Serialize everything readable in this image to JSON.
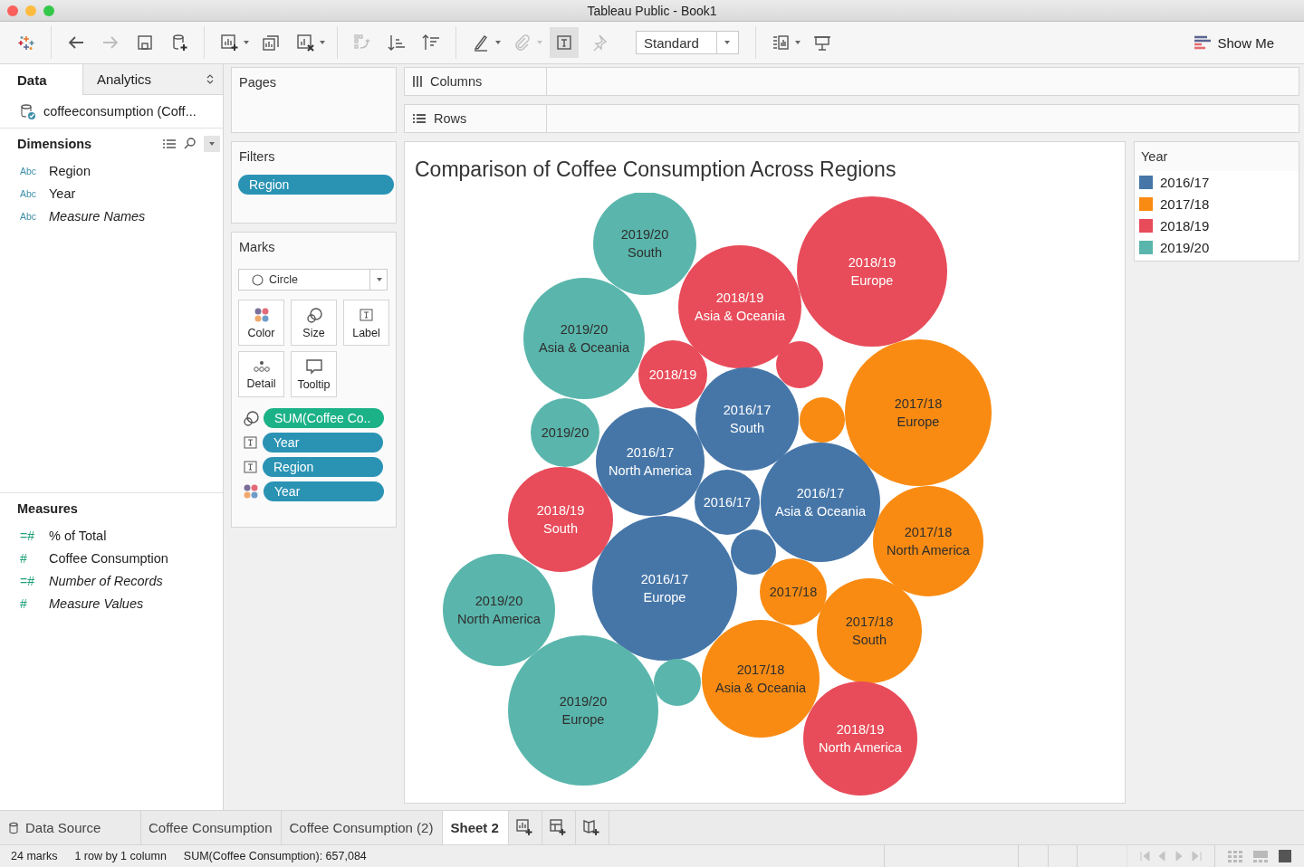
{
  "window": {
    "title": "Tableau Public - Book1"
  },
  "toolbar": {
    "buttons": [
      {
        "disabled": false,
        "pressed": false
      },
      {
        "disabled": false,
        "pressed": false
      },
      {
        "disabled": true,
        "pressed": false
      },
      {
        "disabled": false,
        "pressed": false
      },
      {
        "disabled": false,
        "pressed": false
      },
      {
        "disabled": false,
        "pressed": false
      },
      {
        "disabled": false,
        "pressed": false
      },
      {
        "disabled": false,
        "pressed": false
      },
      {
        "disabled": true,
        "pressed": false
      },
      {
        "disabled": false,
        "pressed": false
      },
      {
        "disabled": false,
        "pressed": false
      },
      {
        "disabled": false,
        "pressed": false
      },
      {
        "disabled": true,
        "pressed": false
      },
      {
        "disabled": false,
        "pressed": true
      },
      {
        "disabled": true,
        "pressed": false
      },
      {
        "disabled": false,
        "pressed": false
      },
      {
        "disabled": false,
        "pressed": false
      }
    ],
    "fit_dropdown": {
      "value": "Standard"
    },
    "show_me": {
      "label": "Show Me"
    }
  },
  "data_pane": {
    "tabs": [
      {
        "label": "Data",
        "selected": true
      },
      {
        "label": "Analytics",
        "selected": false
      }
    ],
    "datasource": "coffeeconsumption (Coff...",
    "dimensions": {
      "title": "Dimensions",
      "fields": [
        {
          "type_label": "Abc",
          "name": "Region",
          "italic": false
        },
        {
          "type_label": "Abc",
          "name": "Year",
          "italic": false
        },
        {
          "type_label": "Abc",
          "name": "Measure Names",
          "italic": true
        }
      ]
    },
    "measures": {
      "title": "Measures",
      "fields": [
        {
          "type_label": "=#",
          "name": "% of Total",
          "italic": false
        },
        {
          "type_label": "#",
          "name": "Coffee Consumption",
          "italic": false
        },
        {
          "type_label": "=#",
          "name": "Number of Records",
          "italic": true
        },
        {
          "type_label": "#",
          "name": "Measure Values",
          "italic": true
        }
      ]
    }
  },
  "pages": {
    "title": "Pages"
  },
  "filters": {
    "title": "Filters",
    "pills": [
      {
        "label": "Region",
        "measure": false
      }
    ]
  },
  "marks": {
    "title": "Marks",
    "mark_type": "Circle",
    "cards": [
      {
        "kind": "color",
        "label": "Color"
      },
      {
        "kind": "size",
        "label": "Size"
      },
      {
        "kind": "label",
        "label": "Label"
      },
      {
        "kind": "detail",
        "label": "Detail"
      },
      {
        "kind": "tooltip",
        "label": "Tooltip"
      }
    ],
    "shelf": [
      {
        "kind": "size",
        "label": "SUM(Coffee Co..",
        "measure": true
      },
      {
        "kind": "label",
        "label": "Year",
        "measure": false
      },
      {
        "kind": "label",
        "label": "Region",
        "measure": false
      },
      {
        "kind": "color",
        "label": "Year",
        "measure": false
      }
    ]
  },
  "columns_shelf": {
    "label": "Columns"
  },
  "rows_shelf": {
    "label": "Rows"
  },
  "viz": {
    "title": "Comparison of Coffee Consumption Across Regions",
    "bubbles": [
      {
        "lines": [
          "2019/20",
          "South"
        ],
        "color": "#5ab6ac"
      },
      {
        "lines": [
          "2018/19",
          "Asia & Oceania"
        ],
        "color": "#e84c5a"
      },
      {
        "lines": [
          "2018/19",
          "Europe"
        ],
        "color": "#e84c5a"
      },
      {
        "lines": [
          "2019/20",
          "Asia & Oceania"
        ],
        "color": "#5ab6ac"
      },
      {
        "lines": [
          "2018/19"
        ],
        "color": "#e84c5a"
      },
      {
        "color": "#e84c5a"
      },
      {
        "lines": [
          "2016/17",
          "South"
        ],
        "color": "#4676a8"
      },
      {
        "lines": [
          "2017/18",
          "Europe"
        ],
        "color": "#f98b12"
      },
      {
        "color": "#f98b12"
      },
      {
        "lines": [
          "2019/20"
        ],
        "color": "#5ab6ac"
      },
      {
        "lines": [
          "2016/17",
          "North America"
        ],
        "color": "#4676a8"
      },
      {
        "lines": [
          "2016/17"
        ],
        "color": "#4676a8"
      },
      {
        "lines": [
          "2016/17",
          "Asia & Oceania"
        ],
        "color": "#4676a8"
      },
      {
        "lines": [
          "2018/19",
          "South"
        ],
        "color": "#e84c5a"
      },
      {
        "lines": [
          "2017/18",
          "North America"
        ],
        "color": "#f98b12"
      },
      {
        "color": "#4676a8"
      },
      {
        "lines": [
          "2016/17",
          "Europe"
        ],
        "color": "#4676a8"
      },
      {
        "lines": [
          "2017/18"
        ],
        "color": "#f98b12"
      },
      {
        "lines": [
          "2019/20",
          "North America"
        ],
        "color": "#5ab6ac"
      },
      {
        "lines": [
          "2017/18",
          "South"
        ],
        "color": "#f98b12"
      },
      {
        "color": "#5ab6ac"
      },
      {
        "lines": [
          "2017/18",
          "Asia & Oceania"
        ],
        "color": "#f98b12"
      },
      {
        "lines": [
          "2019/20",
          "Europe"
        ],
        "color": "#5ab6ac"
      },
      {
        "lines": [
          "2018/19",
          "North America"
        ],
        "color": "#e84c5a"
      }
    ]
  },
  "legend": {
    "title": "Year",
    "items": [
      {
        "label": "2016/17",
        "color": "#4676a8"
      },
      {
        "label": "2017/18",
        "color": "#f98b12"
      },
      {
        "label": "2018/19",
        "color": "#e84c5a"
      },
      {
        "label": "2019/20",
        "color": "#5ab6ac"
      }
    ]
  },
  "sheet_tabs": {
    "tabs": [
      {
        "kind": "datasource",
        "label": "Data Source",
        "selected": false
      },
      {
        "kind": "sheet",
        "label": "Coffee Consumption",
        "selected": false
      },
      {
        "kind": "sheet",
        "label": "Coffee Consumption (2)",
        "selected": false
      },
      {
        "kind": "sheet",
        "label": "Sheet 2",
        "selected": true
      }
    ]
  },
  "status_bar": {
    "items": [
      "24 marks",
      "1 row by 1 column",
      "SUM(Coffee Consumption): 657,084"
    ],
    "view_buttons": [
      {
        "selected": false
      },
      {
        "selected": false
      },
      {
        "selected": true
      }
    ]
  }
}
